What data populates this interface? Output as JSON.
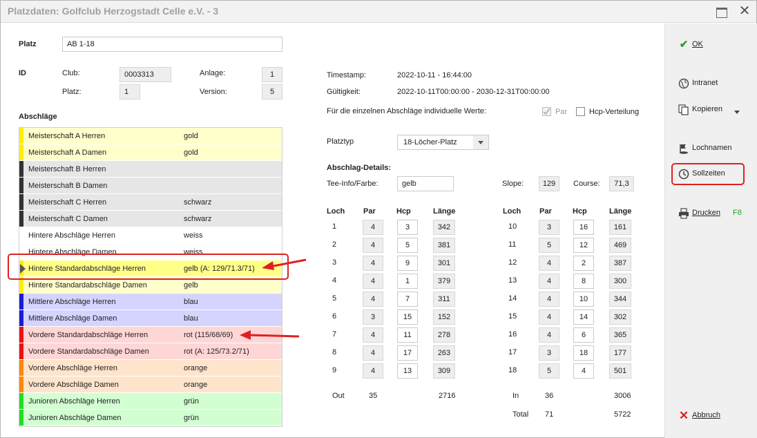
{
  "window": {
    "title": "Platzdaten: Golfclub Herzogstadt Celle e.V. - 3"
  },
  "platz": {
    "label": "Platz",
    "value": "AB 1-18"
  },
  "id_section": {
    "label": "ID",
    "club_label": "Club:",
    "club_value": "0003313",
    "anlage_label": "Anlage:",
    "anlage_value": "1",
    "platz_label": "Platz:",
    "platz_value": "1",
    "version_label": "Version:",
    "version_value": "5"
  },
  "abschlaege": {
    "heading": "Abschläge",
    "rows": [
      {
        "name": "Meisterschaft A Herren",
        "color": "gold",
        "bg": "#ffffcc",
        "stripe": "#ffee00"
      },
      {
        "name": "Meisterschaft A Damen",
        "color": "gold",
        "bg": "#ffffcc",
        "stripe": "#ffee00"
      },
      {
        "name": "Meisterschaft B Herren",
        "color": "",
        "bg": "#e6e6e6",
        "stripe": "#333333"
      },
      {
        "name": "Meisterschaft B Damen",
        "color": "",
        "bg": "#e6e6e6",
        "stripe": "#333333"
      },
      {
        "name": "Meisterschaft C Herren",
        "color": "schwarz",
        "bg": "#e6e6e6",
        "stripe": "#333333"
      },
      {
        "name": "Meisterschaft C Damen",
        "color": "schwarz",
        "bg": "#e6e6e6",
        "stripe": "#333333"
      },
      {
        "name": "Hintere Abschläge Herren",
        "color": "weiss",
        "bg": "#ffffff",
        "stripe": "#ffffff"
      },
      {
        "name": "Hintere Abschläge Damen",
        "color": "weiss",
        "bg": "#ffffff",
        "stripe": "#ffffff"
      },
      {
        "name": "Hintere Standardabschläge Herren",
        "color": "gelb (A: 129/71.3/71)",
        "bg": "#ffff88",
        "stripe": "#ffee00"
      },
      {
        "name": "Hintere Standardabschläge Damen",
        "color": "gelb",
        "bg": "#ffffcc",
        "stripe": "#ffee00"
      },
      {
        "name": "Mittlere Abschläge Herren",
        "color": "blau",
        "bg": "#d4d4ff",
        "stripe": "#1a1adb"
      },
      {
        "name": "Mittlere Abschläge Damen",
        "color": "blau",
        "bg": "#d4d4ff",
        "stripe": "#1a1adb"
      },
      {
        "name": "Vordere Standardabschläge Herren",
        "color": "rot (115/68/69)",
        "bg": "#ffd6d6",
        "stripe": "#ee1111"
      },
      {
        "name": "Vordere Standardabschläge Damen",
        "color": "rot (A: 125/73.2/71)",
        "bg": "#ffd6d6",
        "stripe": "#ee1111"
      },
      {
        "name": "Vordere Abschläge Herren",
        "color": "orange",
        "bg": "#ffe4cc",
        "stripe": "#ff8800"
      },
      {
        "name": "Vordere Abschläge Damen",
        "color": "orange",
        "bg": "#ffe4cc",
        "stripe": "#ff8800"
      },
      {
        "name": "Junioren Abschläge Herren",
        "color": "grün",
        "bg": "#d2ffd2",
        "stripe": "#22dd22"
      },
      {
        "name": "Junioren Abschläge Damen",
        "color": "grün",
        "bg": "#d2ffd2",
        "stripe": "#22dd22"
      }
    ]
  },
  "meta": {
    "timestamp_label": "Timestamp:",
    "timestamp_value": "2022-10-11 - 16:44:00",
    "gueltig_label": "Gültigkeit:",
    "gueltig_value": "2022-10-11T00:00:00  - 2030-12-31T00:00:00",
    "individuell_label": "Für die einzelnen Abschläge individuelle Werte:",
    "par_label": "Par",
    "hcp_label": "Hcp-Verteilung",
    "platztyp_label": "Platztyp",
    "platztyp_value": "18-Löcher-Platz"
  },
  "details": {
    "heading": "Abschlag-Details:",
    "tee_label": "Tee-Info/Farbe:",
    "tee_value": "gelb",
    "slope_label": "Slope:",
    "slope_value": "129",
    "course_label": "Course:",
    "course_value": "71,3"
  },
  "holes": {
    "col_loch": "Loch",
    "col_par": "Par",
    "col_hcp": "Hcp",
    "col_laenge": "Länge",
    "front": [
      {
        "loch": "1",
        "par": "4",
        "hcp": "3",
        "laenge": "342"
      },
      {
        "loch": "2",
        "par": "4",
        "hcp": "5",
        "laenge": "381"
      },
      {
        "loch": "3",
        "par": "4",
        "hcp": "9",
        "laenge": "301"
      },
      {
        "loch": "4",
        "par": "4",
        "hcp": "1",
        "laenge": "379"
      },
      {
        "loch": "5",
        "par": "4",
        "hcp": "7",
        "laenge": "311"
      },
      {
        "loch": "6",
        "par": "3",
        "hcp": "15",
        "laenge": "152"
      },
      {
        "loch": "7",
        "par": "4",
        "hcp": "11",
        "laenge": "278"
      },
      {
        "loch": "8",
        "par": "4",
        "hcp": "17",
        "laenge": "263"
      },
      {
        "loch": "9",
        "par": "4",
        "hcp": "13",
        "laenge": "309"
      }
    ],
    "back": [
      {
        "loch": "10",
        "par": "3",
        "hcp": "16",
        "laenge": "161"
      },
      {
        "loch": "11",
        "par": "5",
        "hcp": "12",
        "laenge": "469"
      },
      {
        "loch": "12",
        "par": "4",
        "hcp": "2",
        "laenge": "387"
      },
      {
        "loch": "13",
        "par": "4",
        "hcp": "8",
        "laenge": "300"
      },
      {
        "loch": "14",
        "par": "4",
        "hcp": "10",
        "laenge": "344"
      },
      {
        "loch": "15",
        "par": "4",
        "hcp": "14",
        "laenge": "302"
      },
      {
        "loch": "16",
        "par": "4",
        "hcp": "6",
        "laenge": "365"
      },
      {
        "loch": "17",
        "par": "3",
        "hcp": "18",
        "laenge": "177"
      },
      {
        "loch": "18",
        "par": "5",
        "hcp": "4",
        "laenge": "501"
      }
    ],
    "out_label": "Out",
    "out_par": "35",
    "out_laenge": "2716",
    "in_label": "In",
    "in_par": "36",
    "in_laenge": "3006",
    "total_label": "Total",
    "total_par": "71",
    "total_laenge": "5722"
  },
  "sidebar": {
    "ok": "OK",
    "intranet": "Intranet",
    "kopieren": "Kopieren",
    "lochnamen": "Lochnamen",
    "sollzeiten": "Sollzeiten",
    "drucken": "Drucken",
    "drucken_key": "F8",
    "abbruch": "Abbruch"
  },
  "colors": {
    "annotation_red": "#e02020",
    "ok_green": "#2a9d2a",
    "key_green": "#2a9d2a",
    "cancel_red": "#dd2222"
  }
}
